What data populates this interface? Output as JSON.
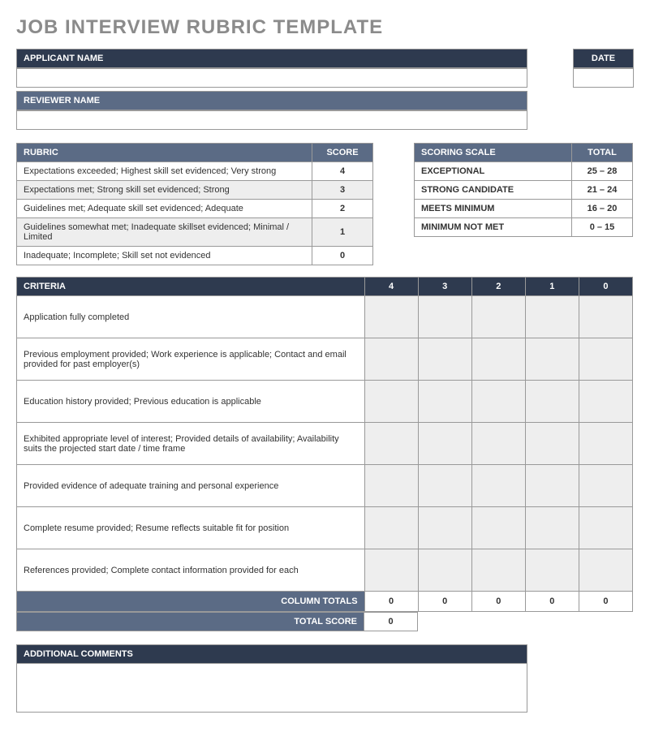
{
  "title": "JOB INTERVIEW RUBRIC TEMPLATE",
  "labels": {
    "applicant_name": "APPLICANT NAME",
    "date": "DATE",
    "reviewer_name": "REVIEWER NAME",
    "rubric": "RUBRIC",
    "score": "SCORE",
    "scoring_scale": "SCORING SCALE",
    "total": "TOTAL",
    "criteria": "CRITERIA",
    "column_totals": "COLUMN TOTALS",
    "total_score": "TOTAL SCORE",
    "additional_comments": "ADDITIONAL COMMENTS"
  },
  "fields": {
    "applicant_name": "",
    "date": "",
    "reviewer_name": "",
    "additional_comments": ""
  },
  "rubric_rows": [
    {
      "desc": "Expectations exceeded; Highest skill set evidenced; Very strong",
      "score": "4"
    },
    {
      "desc": "Expectations met; Strong skill set evidenced; Strong",
      "score": "3"
    },
    {
      "desc": "Guidelines met; Adequate skill set evidenced; Adequate",
      "score": "2"
    },
    {
      "desc": "Guidelines somewhat met; Inadequate skillset evidenced; Minimal / Limited",
      "score": "1"
    },
    {
      "desc": "Inadequate; Incomplete; Skill set not evidenced",
      "score": "0"
    }
  ],
  "scale_rows": [
    {
      "label": "EXCEPTIONAL",
      "range": "25 – 28"
    },
    {
      "label": "STRONG CANDIDATE",
      "range": "21 – 24"
    },
    {
      "label": "MEETS MINIMUM",
      "range": "16 – 20"
    },
    {
      "label": "MINIMUM NOT MET",
      "range": "0 – 15"
    }
  ],
  "criteria_headers": [
    "4",
    "3",
    "2",
    "1",
    "0"
  ],
  "criteria_rows": [
    "Application fully completed",
    "Previous employment provided; Work experience is applicable; Contact and email provided for past employer(s)",
    "Education history provided; Previous education is applicable",
    "Exhibited appropriate level of interest; Provided details of availability; Availability suits the projected start date / time frame",
    "Provided evidence of adequate training and personal experience",
    "Complete resume provided; Resume reflects suitable fit for position",
    "References provided; Complete contact information provided for each"
  ],
  "column_totals": [
    "0",
    "0",
    "0",
    "0",
    "0"
  ],
  "total_score": "0"
}
